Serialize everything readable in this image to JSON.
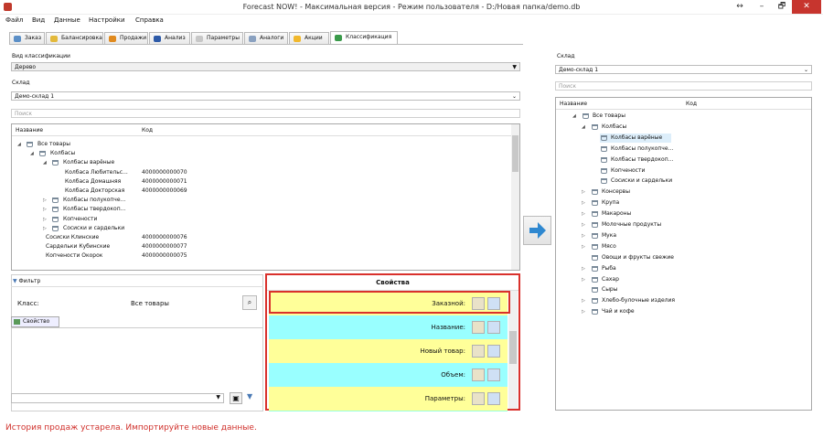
{
  "window": {
    "title": "Forecast NOW! - Максимальная версия - Режим пользователя - D:/Новая папка/demo.db",
    "controls": [
      "↔",
      "–",
      "🗗",
      "✕"
    ]
  },
  "menu": [
    "Файл",
    "Вид",
    "Данные",
    "Настройки",
    "Справка"
  ],
  "tabs": [
    {
      "label": "Заказ",
      "color": "#5b8fc7"
    },
    {
      "label": "Балансировка",
      "color": "#e3b93b"
    },
    {
      "label": "Продажи",
      "color": "#e08a1e"
    },
    {
      "label": "Анализ",
      "color": "#2d5aa8"
    },
    {
      "label": "Параметры",
      "color": "#c7c7c7"
    },
    {
      "label": "Аналоги",
      "color": "#8aa1c0"
    },
    {
      "label": "Акции",
      "color": "#f1b82d"
    },
    {
      "label": "Классификация",
      "color": "#3a9a4a"
    }
  ],
  "left": {
    "class_type_label": "Вид классификации",
    "class_type_value": "Дерево",
    "warehouse_label": "Склад",
    "warehouse_value": "Демо-склад 1",
    "search_placeholder": "Поиск",
    "col_name": "Название",
    "col_code": "Код",
    "rows": [
      {
        "name": "Все товары",
        "code": "",
        "indent": 0,
        "exp": "◢",
        "icon": true
      },
      {
        "name": "Колбасы",
        "code": "",
        "indent": 1,
        "exp": "◢",
        "icon": true
      },
      {
        "name": "Колбасы варёные",
        "code": "",
        "indent": 2,
        "exp": "◢",
        "icon": true
      },
      {
        "name": "Колбаса Любительс...",
        "code": "4000000000070",
        "indent": 3,
        "exp": "",
        "icon": false
      },
      {
        "name": "Колбаса Домашняя",
        "code": "4000000000071",
        "indent": 3,
        "exp": "",
        "icon": false
      },
      {
        "name": "Колбаса Докторская",
        "code": "4000000000069",
        "indent": 3,
        "exp": "",
        "icon": false
      },
      {
        "name": "Колбасы полукопче...",
        "code": "",
        "indent": 2,
        "exp": "▷",
        "icon": true
      },
      {
        "name": "Колбасы твердокоп...",
        "code": "",
        "indent": 2,
        "exp": "▷",
        "icon": true
      },
      {
        "name": "Копчености",
        "code": "",
        "indent": 2,
        "exp": "▷",
        "icon": true
      },
      {
        "name": "Сосиски и сардельки",
        "code": "",
        "indent": 2,
        "exp": "▷",
        "icon": true
      },
      {
        "name": "Сосиски Клинские",
        "code": "4000000000076",
        "indent": 1.5,
        "exp": "",
        "icon": false
      },
      {
        "name": "Сардельки Кубинские",
        "code": "4000000000077",
        "indent": 1.5,
        "exp": "",
        "icon": false
      },
      {
        "name": "Копчености Окорок",
        "code": "4000000000075",
        "indent": 1.5,
        "exp": "",
        "icon": false
      }
    ]
  },
  "filter": {
    "title": "Фильтр",
    "class_label": "Класс:",
    "class_value": "Все товары",
    "property_button": "Свойство"
  },
  "properties": {
    "title": "Свойства",
    "items": [
      {
        "label": "Заказной:",
        "bg": "#ffff99"
      },
      {
        "label": "Название:",
        "bg": "#99ffff"
      },
      {
        "label": "Новый товар:",
        "bg": "#ffff99"
      },
      {
        "label": "Объем:",
        "bg": "#99ffff"
      },
      {
        "label": "Параметры:",
        "bg": "#ffff99"
      }
    ]
  },
  "right": {
    "warehouse_label": "Склад",
    "warehouse_value": "Демо-склад 1",
    "search_placeholder": "Поиск",
    "col_name": "Название",
    "col_code": "Код",
    "rows": [
      {
        "name": "Все товары",
        "indent": 0,
        "exp": "◢",
        "sel": false
      },
      {
        "name": "Колбасы",
        "indent": 1,
        "exp": "◢",
        "sel": false
      },
      {
        "name": "Колбасы варёные",
        "indent": 2,
        "exp": "",
        "sel": true
      },
      {
        "name": "Колбасы полукопче...",
        "indent": 2,
        "exp": "",
        "sel": false
      },
      {
        "name": "Колбасы твердокоп...",
        "indent": 2,
        "exp": "",
        "sel": false
      },
      {
        "name": "Копчености",
        "indent": 2,
        "exp": "",
        "sel": false
      },
      {
        "name": "Сосиски и сардельки",
        "indent": 2,
        "exp": "",
        "sel": false
      },
      {
        "name": "Консервы",
        "indent": 1,
        "exp": "▷",
        "sel": false
      },
      {
        "name": "Крупа",
        "indent": 1,
        "exp": "▷",
        "sel": false
      },
      {
        "name": "Макароны",
        "indent": 1,
        "exp": "▷",
        "sel": false
      },
      {
        "name": "Молочные продукты",
        "indent": 1,
        "exp": "▷",
        "sel": false
      },
      {
        "name": "Мука",
        "indent": 1,
        "exp": "▷",
        "sel": false
      },
      {
        "name": "Мясо",
        "indent": 1,
        "exp": "▷",
        "sel": false
      },
      {
        "name": "Овощи и фрукты свежие",
        "indent": 1,
        "exp": "",
        "sel": false
      },
      {
        "name": "Рыба",
        "indent": 1,
        "exp": "▷",
        "sel": false
      },
      {
        "name": "Сахар",
        "indent": 1,
        "exp": "▷",
        "sel": false
      },
      {
        "name": "Сыры",
        "indent": 1,
        "exp": "",
        "sel": false
      },
      {
        "name": "Хлебо-булочные изделия",
        "indent": 1,
        "exp": "▷",
        "sel": false
      },
      {
        "name": "Чай и кофе",
        "indent": 1,
        "exp": "▷",
        "sel": false
      }
    ]
  },
  "status": "История продаж устарела. Импортируйте новые данные."
}
